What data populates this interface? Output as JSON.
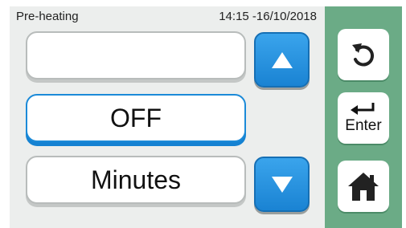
{
  "status": {
    "title": "Pre-heating",
    "datetime": "14:15 -16/10/2018"
  },
  "fields": {
    "top_value": "",
    "middle_value": "OFF",
    "bottom_value": "Minutes"
  },
  "controls": {
    "up_icon": "up-arrow-icon",
    "down_icon": "down-arrow-icon",
    "enter_label": "Enter",
    "back_icon": "back-undo-icon",
    "home_icon": "home-icon"
  },
  "colors": {
    "accent_blue": "#1a83d3",
    "sidebar_green": "#6bab86",
    "screen_gray": "#eceeed"
  }
}
